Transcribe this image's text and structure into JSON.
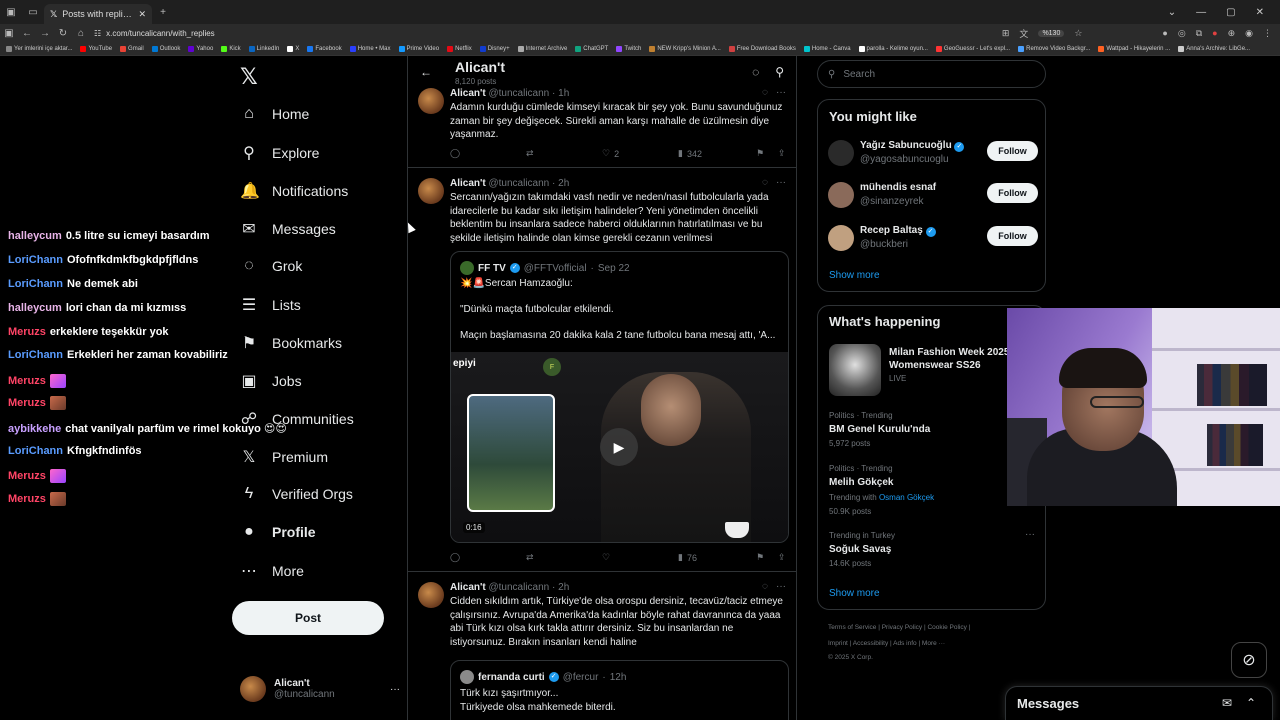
{
  "browser": {
    "tab_title": "Posts with replies by Alican't (@",
    "url": "x.com/tuncalicann/with_replies",
    "zoom": "%130",
    "bookmarks": [
      {
        "label": "Yer imlerini içe aktar...",
        "color": "#888888"
      },
      {
        "label": "YouTube",
        "color": "#ff0000"
      },
      {
        "label": "Gmail",
        "color": "#ea4335"
      },
      {
        "label": "Outlook",
        "color": "#0078d4"
      },
      {
        "label": "Yahoo",
        "color": "#6001d2"
      },
      {
        "label": "Kick",
        "color": "#53fc18"
      },
      {
        "label": "LinkedIn",
        "color": "#0a66c2"
      },
      {
        "label": "X",
        "color": "#ffffff"
      },
      {
        "label": "Facebook",
        "color": "#1877f2"
      },
      {
        "label": "Home • Max",
        "color": "#2a3fff"
      },
      {
        "label": "Prime Video",
        "color": "#1399ff"
      },
      {
        "label": "Netflix",
        "color": "#e50914"
      },
      {
        "label": "Disney+",
        "color": "#113ccf"
      },
      {
        "label": "Internet Archive",
        "color": "#aaaaaa"
      },
      {
        "label": "ChatGPT",
        "color": "#10a37f"
      },
      {
        "label": "Twitch",
        "color": "#9146ff"
      },
      {
        "label": "NEW Kripp's Minion A...",
        "color": "#c08030"
      },
      {
        "label": "Free Download Books",
        "color": "#d04040"
      },
      {
        "label": "Home - Canva",
        "color": "#00c4cc"
      },
      {
        "label": "parolla - Kelime oyun...",
        "color": "#ffffff"
      },
      {
        "label": "GeoGuessr - Let's expl...",
        "color": "#ff3333"
      },
      {
        "label": "Remove Video Backgr...",
        "color": "#4aa0ff"
      },
      {
        "label": "Wattpad - Hikayelerin ...",
        "color": "#ff6122"
      },
      {
        "label": "Anna's Archive: LibGe...",
        "color": "#cccccc"
      }
    ]
  },
  "nav": {
    "items": [
      {
        "label": "Home",
        "icon": "⌂",
        "bold": false
      },
      {
        "label": "Explore",
        "icon": "⚲",
        "bold": false
      },
      {
        "label": "Notifications",
        "icon": "🔔",
        "bold": false
      },
      {
        "label": "Messages",
        "icon": "✉",
        "bold": false
      },
      {
        "label": "Grok",
        "icon": "◌",
        "bold": false
      },
      {
        "label": "Lists",
        "icon": "☰",
        "bold": false
      },
      {
        "label": "Bookmarks",
        "icon": "⚑",
        "bold": false
      },
      {
        "label": "Jobs",
        "icon": "▣",
        "bold": false
      },
      {
        "label": "Communities",
        "icon": "☍",
        "bold": false
      },
      {
        "label": "Premium",
        "icon": "𝕏",
        "bold": false
      },
      {
        "label": "Verified Orgs",
        "icon": "ϟ",
        "bold": false
      },
      {
        "label": "Profile",
        "icon": "●",
        "bold": true
      },
      {
        "label": "More",
        "icon": "⋯",
        "bold": false
      }
    ],
    "post_label": "Post",
    "account": {
      "name": "Alican't",
      "handle": "@tuncalicann",
      "more": "···"
    }
  },
  "chat": [
    {
      "user": "halleycum",
      "color": "#e8b4e8",
      "msg": "0.5 litre su icmeyi basardım"
    },
    {
      "user": "LoriChann",
      "color": "#5a9cff",
      "msg": "Ofofnfkdmkfbgkdpfjfldns"
    },
    {
      "user": "LoriChann",
      "color": "#5a9cff",
      "msg": "Ne demek abi"
    },
    {
      "user": "halleycum",
      "color": "#e8b4e8",
      "msg": "lori chan da mi kızmıss"
    },
    {
      "user": "Meruzs",
      "color": "#ff4466",
      "msg": "erkeklere teşekkür yok"
    },
    {
      "user": "LoriChann",
      "color": "#5a9cff",
      "msg": "Erkekleri her zaman kovabiliriz"
    },
    {
      "user": "Meruzs",
      "color": "#ff4466",
      "msg": ""
    },
    {
      "user": "Meruzs",
      "color": "#ff4466",
      "msg": ""
    },
    {
      "user": "aybikkehe",
      "color": "#c8a0ff",
      "msg": "chat vanilyalı parfüm ve rimel kokuyo"
    },
    {
      "user": "LoriChann",
      "color": "#5a9cff",
      "msg": "Kfngkfndinfös"
    },
    {
      "user": "Meruzs",
      "color": "#ff4466",
      "msg": ""
    },
    {
      "user": "Meruzs",
      "color": "#ff4466",
      "msg": ""
    }
  ],
  "timeline": {
    "title": "Alican't",
    "post_count": "8,120 posts",
    "tweets": [
      {
        "name": "Alican't",
        "handle": "@tuncalicann",
        "time": "1h",
        "text": "Adamın kurduğu cümlede kimseyi kıracak bir şey yok. Bunu savunduğunuz zaman bir şey değişecek. Sürekli aman karşı mahalle de üzülmesin diye yaşanmaz.",
        "likes": "2",
        "views": "342"
      },
      {
        "name": "Alican't",
        "handle": "@tuncalicann",
        "time": "2h",
        "text": "Sercanın/yağızın takımdaki vasfı nedir ve neden/nasıl futbolcularla yada idarecilerle bu kadar sıkı iletişim halindeler? Yeni yönetimden öncelikli beklentim bu insanlara sadece haberci olduklarının hatırlatılması ve bu şekilde iletişim halinde olan kimse gerekli cezanın verilmesi",
        "views": "76",
        "quote": {
          "name": "FF TV",
          "handle": "@FFTVofficial",
          "date": "Sep 22",
          "line1": "💥🚨Sercan Hamzaoğlu:",
          "line2": "\"Dünkü maçta futbolcular etkilendi.",
          "line3": "Maçın başlamasına 20 dakika kala 2 tane futbolcu bana mesaj attı, 'A...",
          "video_time": "0:16",
          "brand": "epiyi",
          "badge": "F"
        }
      },
      {
        "name": "Alican't",
        "handle": "@tuncalicann",
        "time": "2h",
        "text": "Cidden sıkıldım artık, Türkiye'de olsa orospu dersiniz, tecavüz/taciz etmeye çalışırsınız. Avrupa'da Amerika'da kadınlar böyle rahat davranınca da yaaa abi Türk kızı olsa kırk takla attırır dersiniz. Siz bu insanlardan ne istiyorsunuz. Bırakın insanları kendi haline",
        "quote": {
          "name": "fernanda curti",
          "handle": "@fercur",
          "date": "12h",
          "line1": "Türk kızı şaşırtmıyor...",
          "line2": "Türkiyede olsa mahkemede biterdi."
        }
      }
    ]
  },
  "right": {
    "search_placeholder": "Search",
    "might_like_title": "You might like",
    "suggestions": [
      {
        "name": "Yağız Sabuncuoğlu",
        "handle": "@yagosabuncuoglu",
        "verified": true
      },
      {
        "name": "mühendis esnaf",
        "handle": "@sinanzeyrek",
        "verified": false
      },
      {
        "name": "Recep Baltaş",
        "handle": "@buckberi",
        "verified": true
      }
    ],
    "follow_label": "Follow",
    "show_more": "Show more",
    "happening_title": "What's happening",
    "event": {
      "name": "Milan Fashion Week 2025 Womenswear SS26",
      "status": "LIVE"
    },
    "trends": [
      {
        "category": "Politics · Trending",
        "name": "BM Genel Kurulu'nda",
        "posts": "5,972 posts",
        "with_prefix": "",
        "with": ""
      },
      {
        "category": "Politics · Trending",
        "name": "Melih Gökçek",
        "posts": "50.9K posts",
        "with_prefix": "Trending with ",
        "with": "Osman Gökçek"
      },
      {
        "category": "Trending in Turkey",
        "name": "Soğuk Savaş",
        "posts": "14.6K posts",
        "with_prefix": "",
        "with": ""
      }
    ],
    "footer": {
      "line1": "Terms of Service  |  Privacy Policy  |  Cookie Policy  |",
      "line2": "Imprint  |  Accessibility  |  Ads info  |  More ···",
      "line3": "© 2025 X Corp."
    }
  },
  "messages": {
    "title": "Messages"
  },
  "colors": {
    "accent": "#1d9bf0",
    "border": "#2f3336",
    "muted": "#71767b"
  }
}
